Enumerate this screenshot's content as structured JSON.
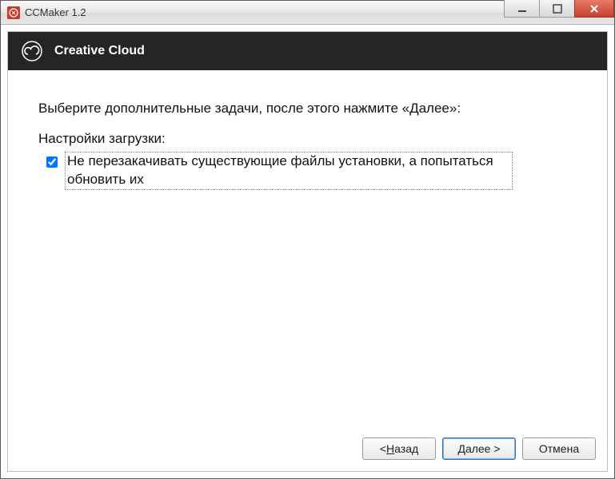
{
  "window": {
    "title": "CCMaker 1.2"
  },
  "header": {
    "product": "Creative Cloud"
  },
  "content": {
    "intro_text": "Выберите дополнительные задачи, после этого нажмите «Далее»:",
    "section_label": "Настройки загрузки:",
    "option1": {
      "checked": true,
      "label": "Не перезакачивать существующие файлы установки, а попытаться обновить их"
    }
  },
  "buttons": {
    "back_prefix": "< ",
    "back_u": "Н",
    "back_rest": "азад",
    "next_u": "Д",
    "next_rest": "алее >",
    "cancel": "Отмена"
  }
}
